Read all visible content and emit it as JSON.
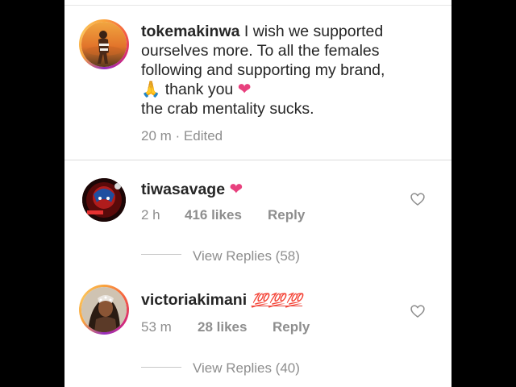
{
  "main_comment": {
    "username": "tokemakinwa",
    "line1": " I wish we supported",
    "line2": "ourselves more. To all the females",
    "line3": "following and supporting my brand,",
    "pray_emoji": "🙏",
    "line4": " thank you ",
    "heart_emoji": "❤",
    "line5": "the  crab mentality sucks.",
    "time": "20 m",
    "separator": " · ",
    "edited": "Edited"
  },
  "replies": [
    {
      "username": "tiwasavage",
      "emoji": "❤",
      "time": "2 h",
      "likes": "416 likes",
      "reply_label": "Reply",
      "view_replies": "View Replies (58)"
    },
    {
      "username": "victoriakimani",
      "emoji": "💯💯💯",
      "time": "53 m",
      "likes": "28 likes",
      "reply_label": "Reply",
      "view_replies": "View Replies (40)"
    }
  ],
  "icons": {
    "like": "heart-outline-icon"
  },
  "colors": {
    "text": "#262626",
    "muted": "#8e8e8e",
    "heart": "#e8417e"
  }
}
